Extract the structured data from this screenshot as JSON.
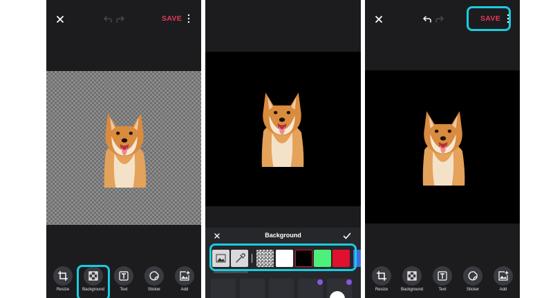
{
  "panel1": {
    "top_bar": {
      "save": "SAVE"
    },
    "tools": [
      {
        "label": "Resize"
      },
      {
        "label": "Background"
      },
      {
        "label": "Text"
      },
      {
        "label": "Sticker"
      },
      {
        "label": "Add"
      }
    ]
  },
  "panel2": {
    "panel_title": "Background",
    "swatches": [
      "gallery",
      "color-picker",
      "transparent",
      "#ffffff",
      "#000000",
      "#4cf07a",
      "#e0112e"
    ]
  },
  "panel3": {
    "top_bar": {
      "save": "SAVE"
    },
    "tools": [
      {
        "label": "Resize"
      },
      {
        "label": "Background"
      },
      {
        "label": "Text"
      },
      {
        "label": "Sticker"
      },
      {
        "label": "Add"
      }
    ]
  },
  "colors": {
    "accent": "#e5395a",
    "highlight": "#19cde0",
    "dark_bg": "#1c1c1f"
  }
}
